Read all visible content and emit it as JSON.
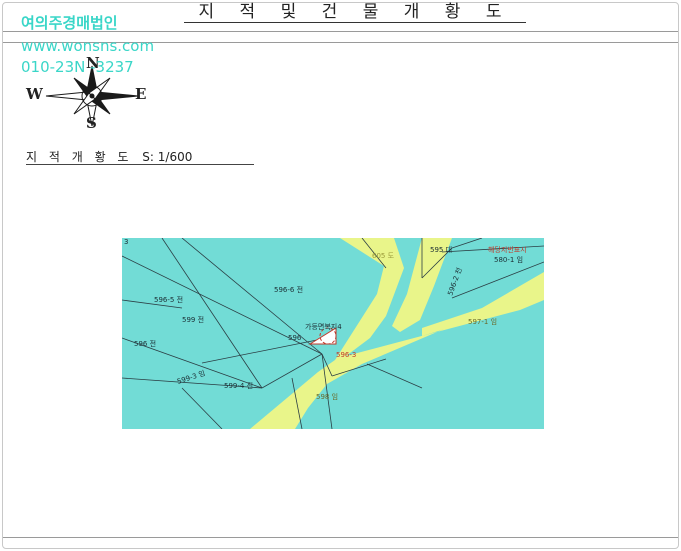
{
  "document": {
    "title": "지 적 및 건 물 개 황 도",
    "scale_label_prefix": "지 적 개 황 도",
    "scale_value": "S: 1/600"
  },
  "watermark": {
    "company": "여의주경매법인",
    "website": "www.wonsns.com",
    "phone": "010-23N -3237",
    "color": "#3ad6c8"
  },
  "compass": {
    "north": "N",
    "south": "S",
    "east": "E",
    "west": "W"
  },
  "map": {
    "colors": {
      "land": "#72dcd6",
      "road": "#e9f58a",
      "lines": "#2b3e44"
    },
    "parcels": {
      "p595": "595 대",
      "p605": "605 도",
      "p580_1": "580-1 임",
      "p596_6": "596-6 전",
      "p596_5": "596-5 전",
      "p599": "599 전",
      "p596": "596 전",
      "p597_1": "597-1 임",
      "p599_3": "599-3 임",
      "p599_4": "599-4 전",
      "p598": "598 임",
      "p596_2": "596-2 천",
      "p596_small": "596",
      "subject": "596-3",
      "left_top": "3"
    },
    "annotations": {
      "subject_title": "가등면복지4",
      "red_corner": "해당지번표시"
    }
  }
}
